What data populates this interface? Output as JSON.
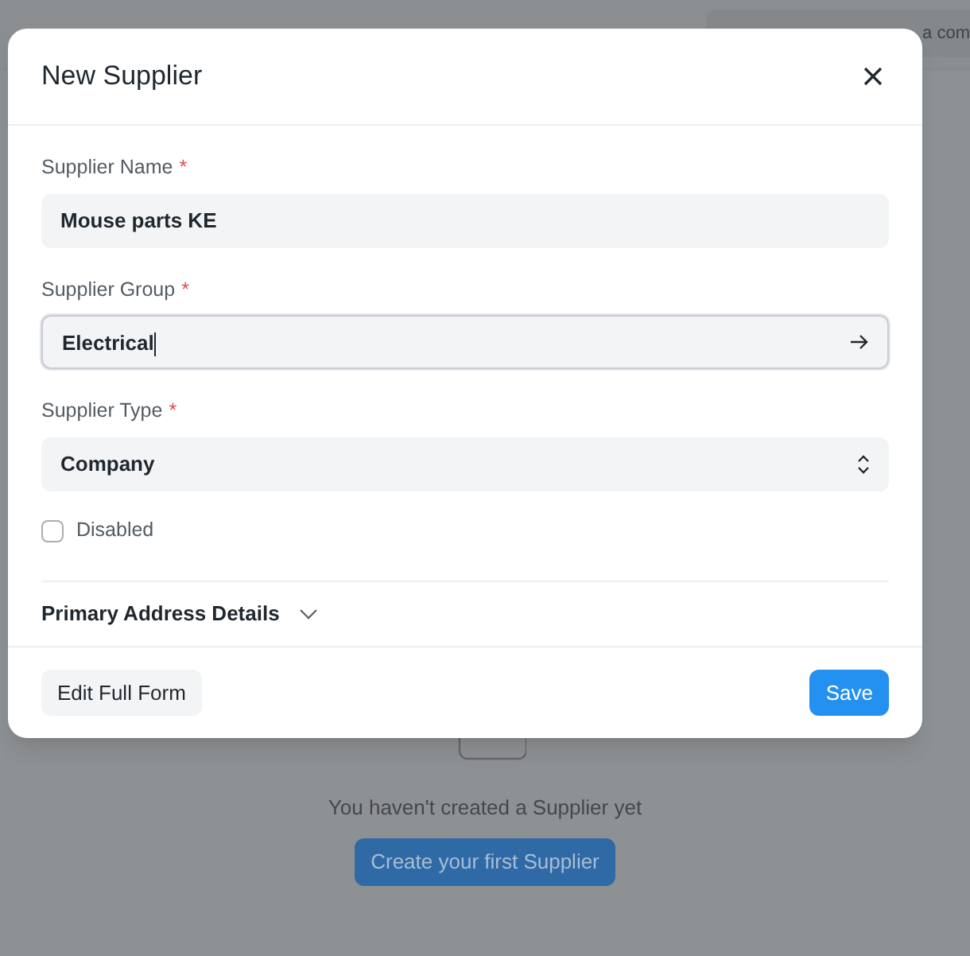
{
  "background": {
    "search": {
      "placeholder": "a com"
    },
    "empty_state": {
      "message": "You haven't created a Supplier yet",
      "button": "Create your first Supplier"
    }
  },
  "dialog": {
    "title": "New Supplier",
    "fields": [
      {
        "kind": "text",
        "label": "Supplier Name",
        "required_mark": "*",
        "value": "Mouse parts KE"
      },
      {
        "kind": "link",
        "label": "Supplier Group",
        "required_mark": "*",
        "value": "Electrical"
      },
      {
        "kind": "select",
        "label": "Supplier Type",
        "required_mark": "*",
        "value": "Company"
      }
    ],
    "checkbox": {
      "label": "Disabled",
      "checked": false
    },
    "section": {
      "label": "Primary Address Details",
      "expanded": false
    },
    "buttons": [
      {
        "kind": "secondary",
        "label": "Edit Full Form"
      },
      {
        "kind": "primary",
        "label": "Save"
      }
    ]
  }
}
